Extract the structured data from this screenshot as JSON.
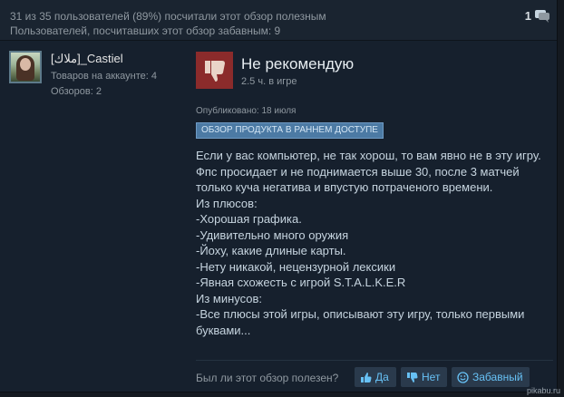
{
  "header": {
    "helpful_line": "31 из 35 пользователей (89%) посчитали этот обзор полезным",
    "funny_line": "Пользователей, посчитавших этот обзор забавным: 9",
    "comment_count": "1"
  },
  "author": {
    "name": "[ملاك]_Castiel",
    "products": "Товаров на аккаунте: 4",
    "reviews": "Обзоров: 2"
  },
  "review": {
    "verdict": "Не рекомендую",
    "hours": "2.5 ч. в игре",
    "posted": "Опубликовано: 18 июля",
    "badge": "ОБЗОР ПРОДУКТА В РАННЕМ ДОСТУПЕ",
    "lines": [
      "Если у вас компьютер, не так хорош, то вам явно не в эту игру.",
      "Фпс просидает и не поднимается выше 30, после 3 матчей",
      "только куча негатива и впустую потраченого времени.",
      "Из плюсов:",
      "-Хорошая графика.",
      "-Удивительно много оружия",
      "-Йоху, какие длиные карты.",
      "-Нету никакой, нецензурной лексики",
      "-Явная схожесть с игрой S.T.A.L.K.E.R",
      "Из минусов:",
      "-Все плюсы этой игры, описывают эту игру, только первыми",
      "буквами..."
    ]
  },
  "footer": {
    "question": "Был ли этот обзор полезен?",
    "yes": "Да",
    "no": "Нет",
    "funny": "Забавный"
  },
  "watermark": "pikabu.ru",
  "colors": {
    "background": "#16202d",
    "thumb_down_bg": "#8b2b2b",
    "badge_bg": "#4c7aa4",
    "vote_text": "#67c1f5"
  },
  "icons": {
    "comment": "speech-bubble-icon",
    "verdict": "thumbs-down-icon",
    "yes": "thumbs-up-icon",
    "no": "thumbs-down-icon",
    "funny": "smiley-icon"
  }
}
